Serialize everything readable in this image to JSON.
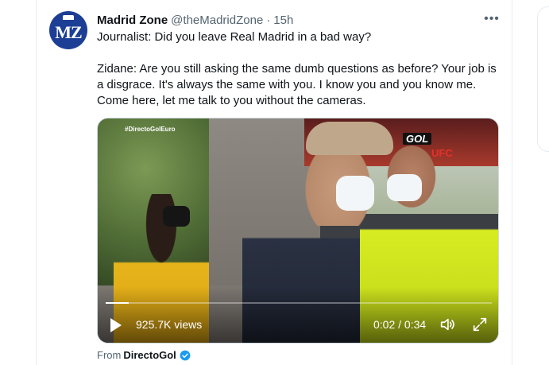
{
  "tweet": {
    "author_name": "Madrid Zone",
    "handle": "@theMadridZone",
    "separator": "·",
    "time": "15h",
    "more_label": "•••",
    "avatar_text": "MZ",
    "text_lines": [
      "Journalist: Did you leave Real Madrid in a bad way?",
      "Zidane: Are you still asking the same dumb questions as before? Your job is a disgrace. It's always the same with you. I know you and you know me. Come here, let me talk to you without the cameras."
    ]
  },
  "video": {
    "overlay_tag": "#DirectoGolEuro",
    "gol_logo": "GOL",
    "ufc_logo": "UFC",
    "views": "925.7K views",
    "timecode": "0:02 / 0:34",
    "progress_fraction": 0.06
  },
  "source": {
    "from_label": "From",
    "source_name": "DirectoGol"
  },
  "colors": {
    "accent": "#1d9bf0",
    "avatar_bg": "#1c3f95",
    "muted_text": "#536471"
  },
  "icons": {
    "more": "more-icon",
    "play": "play-icon",
    "volume": "volume-icon",
    "fullscreen": "fullscreen-icon",
    "verified": "verified-badge-icon"
  }
}
